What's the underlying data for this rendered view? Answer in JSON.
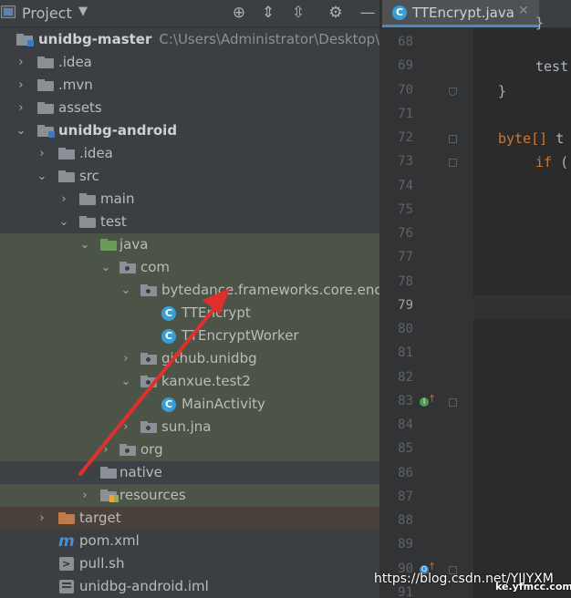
{
  "panel": {
    "title": "Project"
  },
  "tree": [
    {
      "label": "unidbg-master",
      "path": "C:\\Users\\Administrator\\Desktop\\ur",
      "icon": "module-folder-icon",
      "expanded": true
    },
    {
      "label": ".idea",
      "icon": "folder-icon",
      "expanded": false
    },
    {
      "label": ".mvn",
      "icon": "folder-icon",
      "expanded": false
    },
    {
      "label": "assets",
      "icon": "folder-icon",
      "expanded": false
    },
    {
      "label": "unidbg-android",
      "icon": "module-folder-icon",
      "expanded": true
    },
    {
      "label": ".idea",
      "icon": "folder-icon",
      "expanded": false
    },
    {
      "label": "src",
      "icon": "folder-icon",
      "expanded": true
    },
    {
      "label": "main",
      "icon": "folder-icon",
      "expanded": false
    },
    {
      "label": "test",
      "icon": "folder-icon",
      "expanded": true
    },
    {
      "label": "java",
      "icon": "test-source-folder-icon",
      "expanded": true
    },
    {
      "label": "com",
      "icon": "package-icon",
      "expanded": true
    },
    {
      "label": "bytedance.frameworks.core.encry",
      "icon": "package-icon",
      "expanded": true
    },
    {
      "label": "TTEncrypt",
      "icon": "java-class-icon"
    },
    {
      "label": "TTEncryptWorker",
      "icon": "java-class-icon"
    },
    {
      "label": "github.unidbg",
      "icon": "package-icon",
      "expanded": false
    },
    {
      "label": "kanxue.test2",
      "icon": "package-icon",
      "expanded": true
    },
    {
      "label": "MainActivity",
      "icon": "java-class-icon"
    },
    {
      "label": "sun.jna",
      "icon": "package-icon",
      "expanded": false
    },
    {
      "label": "org",
      "icon": "package-icon",
      "expanded": false
    },
    {
      "label": "native",
      "icon": "folder-icon"
    },
    {
      "label": "resources",
      "icon": "resources-folder-icon",
      "expanded": false
    },
    {
      "label": "target",
      "icon": "excluded-folder-icon",
      "expanded": false
    },
    {
      "label": "pom.xml",
      "icon": "maven-icon"
    },
    {
      "label": "pull.sh",
      "icon": "shell-script-icon"
    },
    {
      "label": "unidbg-android.iml",
      "icon": "module-file-icon"
    }
  ],
  "editor": {
    "tab_label": "TTEncrypt.java",
    "line_numbers": [
      "68",
      "69",
      "70",
      "71",
      "72",
      "73",
      "74",
      "75",
      "76",
      "77",
      "78",
      "79",
      "80",
      "81",
      "82",
      "83",
      "84",
      "85",
      "86",
      "87",
      "88",
      "89",
      "90",
      "91"
    ],
    "current_line": "79",
    "code": {
      "top_fragment": "}",
      "l69": "test",
      "l70": "}",
      "l72_type": "byte[]",
      "l72_rest": " t",
      "l73_kw": "if",
      "l73_rest": " ("
    }
  },
  "watermark": {
    "csdn": "https://blog.csdn.net/YJJYXM",
    "corner": "ke.yfmcc.com"
  },
  "colors": {
    "accent": "#4a88c7",
    "annotation_arrow": "#e0302c",
    "test_folder_highlight": "#4b5447",
    "excluded_highlight": "#4a413b"
  }
}
